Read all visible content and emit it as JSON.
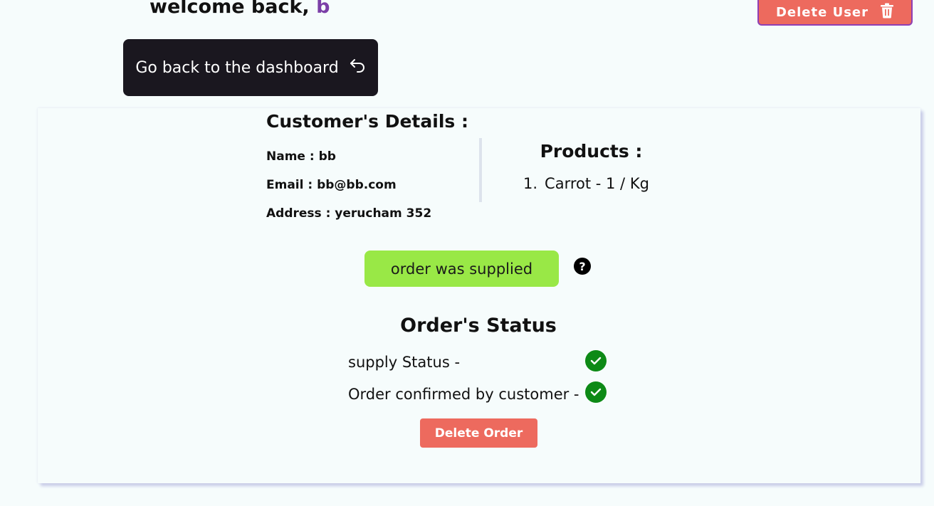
{
  "header": {
    "welcome_prefix": "welcome back, ",
    "username": "b",
    "delete_user_label": "Delete User",
    "back_label": "Go back to the dashboard"
  },
  "customer": {
    "title": "Customer's Details :",
    "name": "Name : bb",
    "email": "Email : bb@bb.com",
    "address": "Address : yerucham 352"
  },
  "products": {
    "title": "Products :",
    "items": [
      {
        "number": "1.",
        "label": "Carrot - 1 / Kg"
      }
    ]
  },
  "order": {
    "supplied_label": "order was supplied",
    "help_symbol": "?",
    "status_title": "Order's Status",
    "supply_status_label": "supply Status -",
    "confirmed_label": "Order confirmed by customer -",
    "supply_status_done": true,
    "confirmed_done": true,
    "delete_order_label": "Delete Order"
  },
  "colors": {
    "background": "#f6fcfc",
    "danger": "#ed6a5e",
    "dark_button": "#1a171f",
    "success_badge": "#99e846",
    "check": "#0d8a16",
    "username_accent": "#7b3fa7"
  },
  "icons": {
    "delete_user": "trash-icon",
    "back": "undo-arrow-icon",
    "help": "question-circle-icon",
    "status_check": "check-circle-icon"
  }
}
